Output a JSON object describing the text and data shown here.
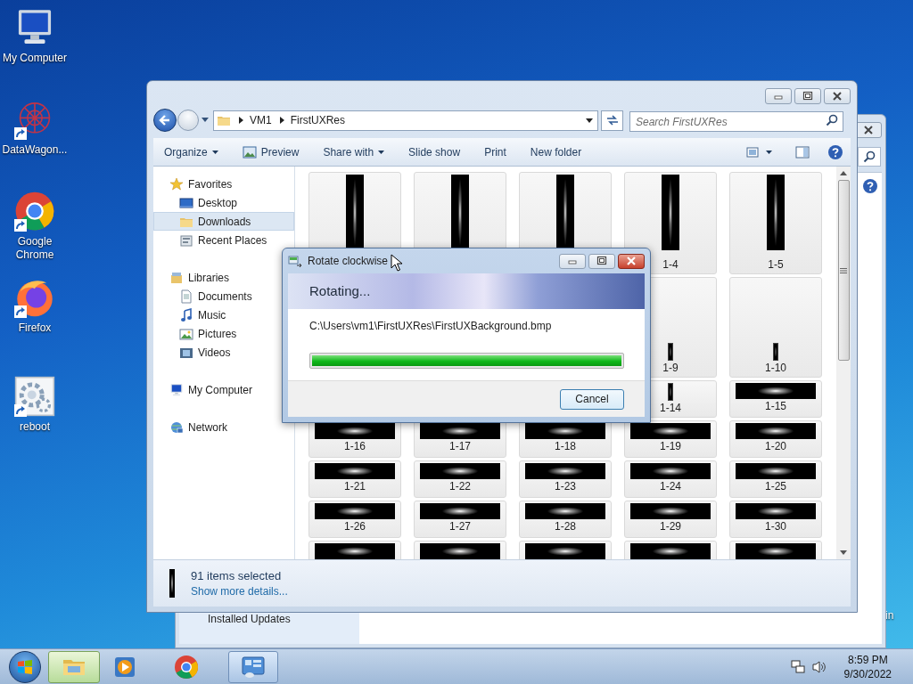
{
  "desktop_icons": [
    {
      "label": "My Computer",
      "kind": "computer"
    },
    {
      "label": "DataWagon...",
      "kind": "network-art"
    },
    {
      "label": "Google Chrome",
      "kind": "chrome"
    },
    {
      "label": "Firefox",
      "kind": "firefox"
    },
    {
      "label": "reboot",
      "kind": "gears"
    }
  ],
  "desktop_fragment": "in",
  "back_window": {
    "sidebar_items": [
      "Installed Updates"
    ]
  },
  "explorer": {
    "breadcrumb": [
      "VM1",
      "FirstUXRes"
    ],
    "search": {
      "placeholder": "Search FirstUXRes"
    },
    "toolbar": [
      {
        "label": "Organize",
        "dropdown": true
      },
      {
        "label": "Preview",
        "dropdown": false,
        "kind": "preview"
      },
      {
        "label": "Share with",
        "dropdown": true
      },
      {
        "label": "Slide show",
        "dropdown": false
      },
      {
        "label": "Print",
        "dropdown": false
      },
      {
        "label": "New folder",
        "dropdown": false
      }
    ],
    "nav": [
      {
        "label": "Favorites",
        "kind": "star",
        "selected": false,
        "children": [
          {
            "label": "Desktop",
            "kind": "desktop",
            "selected": false
          },
          {
            "label": "Downloads",
            "kind": "folder",
            "selected": true
          },
          {
            "label": "Recent Places",
            "kind": "recent",
            "selected": false
          }
        ]
      },
      {
        "label": "Libraries",
        "kind": "library",
        "selected": false,
        "children": [
          {
            "label": "Documents",
            "kind": "document",
            "selected": false
          },
          {
            "label": "Music",
            "kind": "music",
            "selected": false
          },
          {
            "label": "Pictures",
            "kind": "picture",
            "selected": false
          },
          {
            "label": "Videos",
            "kind": "video",
            "selected": false
          }
        ]
      },
      {
        "label": "My Computer",
        "kind": "computer",
        "selected": false
      },
      {
        "label": "Network",
        "kind": "network",
        "selected": false
      }
    ],
    "items": [
      {
        "kind": "tall",
        "selected": true
      },
      {
        "kind": "tall",
        "selected": true
      },
      {
        "kind": "tall",
        "selected": true
      },
      {
        "kind": "tall",
        "selected": true,
        "label": "1-4"
      },
      {
        "kind": "tall",
        "selected": true,
        "label": "1-5"
      },
      {
        "kind": "covered"
      },
      {
        "kind": "covered"
      },
      {
        "kind": "covered"
      },
      {
        "kind": "small",
        "selected": true,
        "label": "1-9"
      },
      {
        "kind": "small",
        "selected": true,
        "label": "1-10"
      },
      {
        "kind": "covered"
      },
      {
        "kind": "covered"
      },
      {
        "kind": "covered"
      },
      {
        "kind": "small",
        "selected": true,
        "label": "1-14"
      },
      {
        "kind": "wide",
        "selected": true,
        "label": "1-15"
      },
      {
        "kind": "wide",
        "selected": true,
        "label": "1-16"
      },
      {
        "kind": "wide",
        "selected": true,
        "label": "1-17"
      },
      {
        "kind": "wide",
        "selected": true,
        "label": "1-18"
      },
      {
        "kind": "wide",
        "selected": true,
        "label": "1-19"
      },
      {
        "kind": "wide",
        "selected": true,
        "label": "1-20"
      },
      {
        "kind": "wide",
        "selected": true,
        "label": "1-21"
      },
      {
        "kind": "wide",
        "selected": true,
        "label": "1-22"
      },
      {
        "kind": "wide",
        "selected": true,
        "label": "1-23"
      },
      {
        "kind": "wide",
        "selected": true,
        "label": "1-24"
      },
      {
        "kind": "wide",
        "selected": true,
        "label": "1-25"
      },
      {
        "kind": "wide",
        "selected": true,
        "label": "1-26"
      },
      {
        "kind": "wide",
        "selected": true,
        "label": "1-27"
      },
      {
        "kind": "wide",
        "selected": true,
        "label": "1-28"
      },
      {
        "kind": "wide",
        "selected": true,
        "label": "1-29"
      },
      {
        "kind": "wide",
        "selected": true,
        "label": "1-30"
      },
      {
        "kind": "wide",
        "selected": true
      },
      {
        "kind": "wide",
        "selected": true
      },
      {
        "kind": "wide",
        "selected": true
      },
      {
        "kind": "wide",
        "selected": true
      },
      {
        "kind": "wide",
        "selected": true
      }
    ],
    "details": {
      "count": "91 items selected",
      "link": "Show more details..."
    }
  },
  "dialog": {
    "title": "Rotate clockwise",
    "heading": "Rotating...",
    "path": "C:\\Users\\vm1\\FirstUXRes\\FirstUXBackground.bmp",
    "progress": {
      "level": 1
    },
    "buttons": [
      "Cancel"
    ]
  },
  "taskbar": {
    "apps": [
      {
        "kind": "explorer",
        "selected": true
      },
      {
        "kind": "media",
        "selected": false
      },
      {
        "kind": "chrome",
        "selected": false
      },
      {
        "kind": "control",
        "selected": false,
        "running": true
      }
    ],
    "time": "8:59 PM",
    "date": "9/30/2022"
  }
}
